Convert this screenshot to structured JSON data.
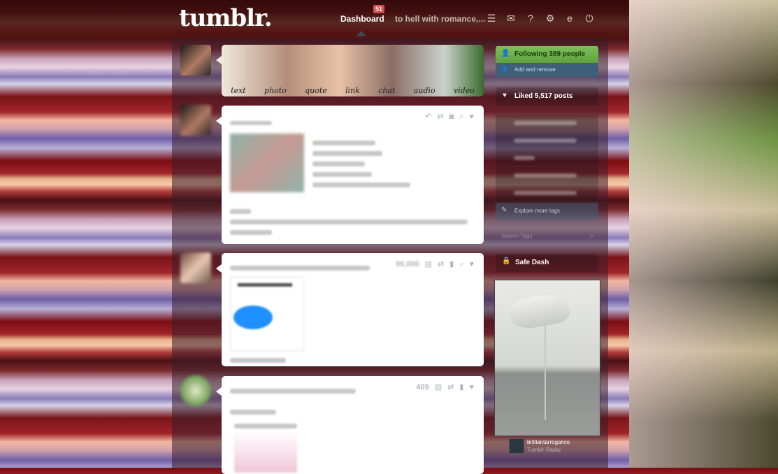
{
  "header": {
    "logo": "tumblr.",
    "dashboard_label": "Dashboard",
    "notification_count": "51",
    "blog_name": "to hell with romance,...",
    "icons": [
      "list-icon",
      "mail-icon",
      "help-icon",
      "gear-icon",
      "e-icon",
      "power-icon"
    ]
  },
  "composer": {
    "types": [
      "text",
      "photo",
      "quote",
      "link",
      "chat",
      "audio",
      "video"
    ]
  },
  "posts": [
    {
      "notes": "",
      "controls": [
        "reply-icon",
        "reblog-icon",
        "camera-icon",
        "search-icon",
        "like-icon"
      ]
    },
    {
      "notes": "",
      "controls": [
        "page-icon",
        "reblog-icon",
        "bookmark-icon",
        "search-icon",
        "like-icon"
      ]
    },
    {
      "notes": "405",
      "controls": [
        "page-icon",
        "reblog-icon",
        "bookmark-icon",
        "like-icon"
      ]
    }
  ],
  "sidebar": {
    "following": "Following 389 people",
    "add_remove": "Add and remove",
    "liked": "Liked 5,517 posts",
    "explore_tags": "Explore more tags",
    "search_tags_placeholder": "Search Tags",
    "safe_dash": "Safe Dash",
    "radar_user": "brilliantarrogance",
    "radar_label": "Tumblr Radar"
  },
  "colors": {
    "following_green": "#6bb04a",
    "radar_border": "#3f5f78"
  }
}
